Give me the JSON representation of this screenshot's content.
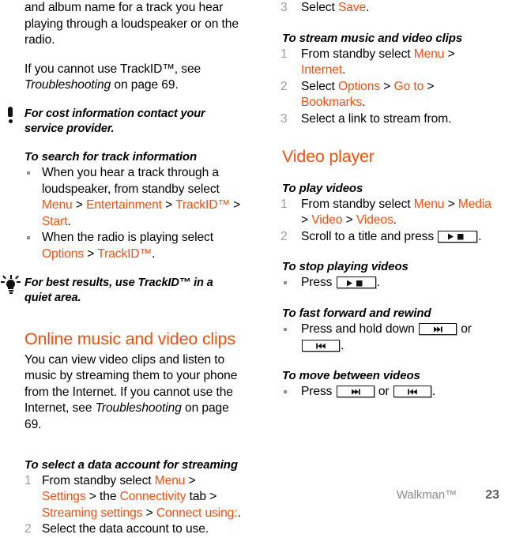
{
  "meta": {
    "accent_orange": "#F0500F",
    "muted_gray": "#9d9d9d",
    "footer_gray": "#8c8c8c"
  },
  "left_column": {
    "intro_paragraph": "and album name for a track you hear playing through a loudspeaker or on the radio.",
    "cannot_use_lead": "If you cannot use TrackID™, see ",
    "cannot_use_italic": "Troubleshooting",
    "cannot_use_tail": " on page 69.",
    "note_cost": {
      "icon": "exclamation-icon",
      "text": "For cost information contact your service provider."
    },
    "proc_search": {
      "heading": "To search for track information",
      "bullets": [
        {
          "lead": "When you hear a track through a loudspeaker, from standby select ",
          "path": [
            "Menu",
            "Entertainment",
            "TrackID™",
            "Start"
          ],
          "tail": "."
        },
        {
          "lead": "When the radio is playing select ",
          "path": [
            "Options",
            "TrackID™"
          ],
          "tail": "."
        }
      ]
    },
    "note_best_results": {
      "icon": "lightbulb-icon",
      "text": "For best results, use TrackID™ in a quiet area."
    },
    "section_online": {
      "heading": "Online music and video clips",
      "paragraph_lead": "You can view video clips and listen to music by streaming them to your phone from the Internet. If you cannot use the Internet, see ",
      "paragraph_italic": "Troubleshooting",
      "paragraph_tail": " on page 69."
    },
    "proc_data_account": {
      "heading": "To select a data account for streaming",
      "steps": [
        {
          "num": "1",
          "lead": "From standby select ",
          "path": [
            "Menu",
            "Settings"
          ],
          "mid_a": " > the ",
          "path_b": "Connectivity",
          "mid_b": " tab > ",
          "path_c": "Streaming settings",
          "mid_c": " > ",
          "path_d": "Connect using:",
          "tail": "."
        },
        {
          "num": "2",
          "text": "Select the data account to use."
        }
      ]
    }
  },
  "right_column": {
    "step_save": {
      "num": "3",
      "lead": "Select ",
      "path": "Save",
      "tail": "."
    },
    "proc_stream": {
      "heading": "To stream music and video clips",
      "steps": [
        {
          "num": "1",
          "lead": "From standby select ",
          "path": [
            "Menu",
            "Internet"
          ],
          "tail": "."
        },
        {
          "num": "2",
          "lead": "Select ",
          "path": [
            "Options",
            "Go to",
            "Bookmarks"
          ],
          "tail": "."
        },
        {
          "num": "3",
          "text": "Select a link to stream from."
        }
      ]
    },
    "section_video_player": {
      "heading": "Video player"
    },
    "proc_play": {
      "heading": "To play videos",
      "steps": [
        {
          "num": "1",
          "lead": "From standby select ",
          "path": [
            "Menu",
            "Media",
            "Video",
            "Videos"
          ],
          "tail": "."
        },
        {
          "num": "2",
          "lead": "Scroll to a title and press ",
          "key": "play-stop-key",
          "tail": "."
        }
      ]
    },
    "proc_stop": {
      "heading": "To stop playing videos",
      "bullet": {
        "lead": "Press ",
        "key": "play-stop-key",
        "tail": "."
      }
    },
    "proc_ffrw": {
      "heading": "To fast forward and rewind",
      "bullet": {
        "lead": "Press and hold down ",
        "key_a": "next-key",
        "mid": " or ",
        "key_b": "previous-key",
        "tail": "."
      }
    },
    "proc_move": {
      "heading": "To move between videos",
      "bullet": {
        "lead": "Press ",
        "key_a": "next-key",
        "mid": " or ",
        "key_b": "previous-key",
        "tail": "."
      }
    }
  },
  "footer": {
    "chapter": "Walkman™",
    "page_number": "23"
  }
}
